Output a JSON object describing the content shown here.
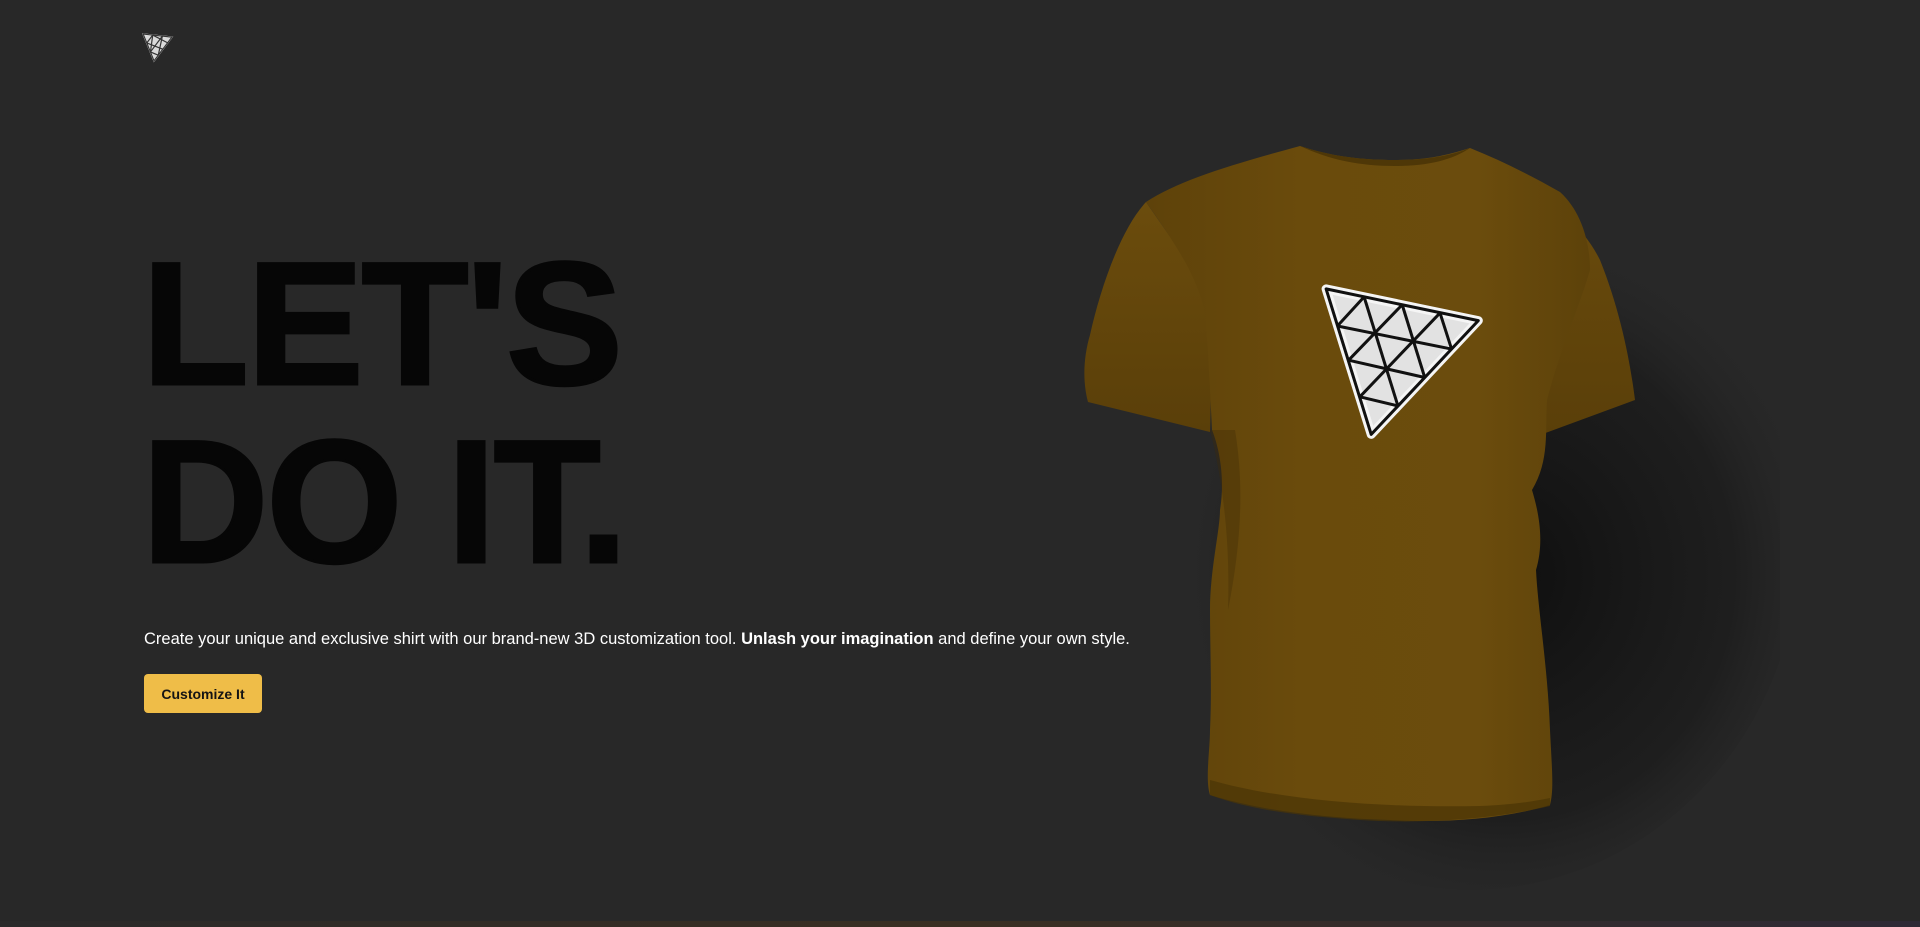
{
  "header": {
    "logo_icon": "triangle-mesh-logo-icon"
  },
  "hero": {
    "headline_line1": "LET'S",
    "headline_line2": "DO IT.",
    "description_start": "Create your unique and exclusive shirt with our brand-new 3D customization tool. ",
    "description_bold": "Unlash your imagination",
    "description_end": " and define your own style.",
    "cta_label": "Customize It"
  },
  "preview": {
    "shirt_icon": "tshirt-3d-model",
    "decal_icon": "triangle-mesh-decal-icon",
    "shirt_color": "#6a4b0c"
  },
  "colors": {
    "background": "#282828",
    "accent": "#efbd48",
    "headline": "#060606"
  }
}
